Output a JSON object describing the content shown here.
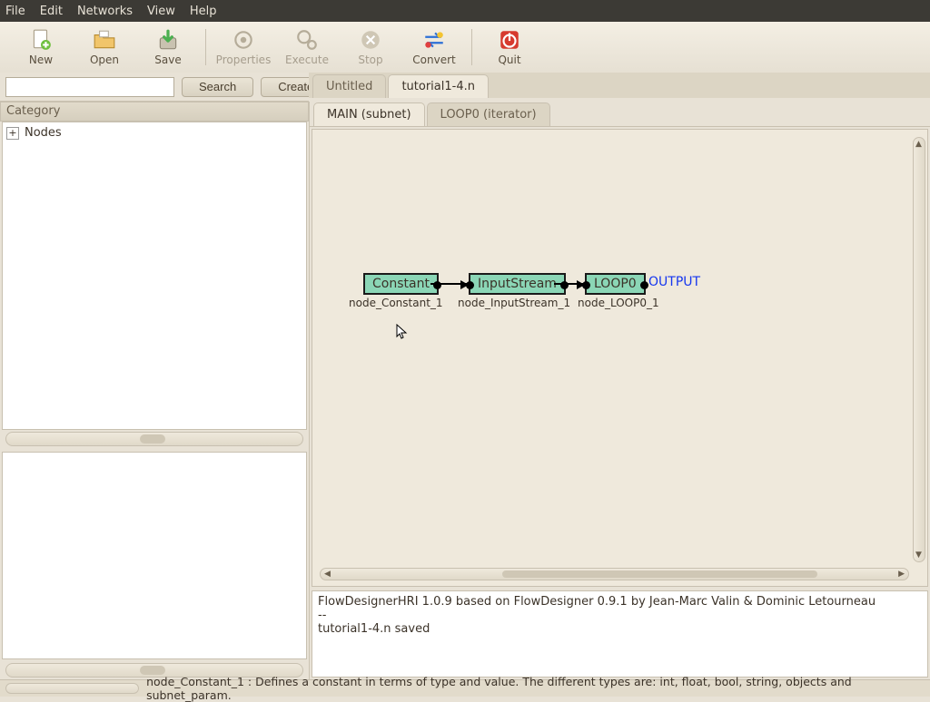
{
  "menu": {
    "items": [
      "File",
      "Edit",
      "Networks",
      "View",
      "Help"
    ]
  },
  "toolbar": {
    "new": "New",
    "open": "Open",
    "save": "Save",
    "properties": "Properties",
    "execute": "Execute",
    "stop": "Stop",
    "convert": "Convert",
    "quit": "Quit"
  },
  "search": {
    "placeholder": "",
    "value": "",
    "search_btn": "Search",
    "create_btn": "Create"
  },
  "sidebar": {
    "category_header": "Category",
    "tree": {
      "root": "Nodes"
    }
  },
  "doc_tabs": {
    "items": [
      "Untitled",
      "tutorial1-4.n"
    ],
    "active_index": 1
  },
  "sub_tabs": {
    "items": [
      "MAIN (subnet)",
      "LOOP0 (iterator)"
    ],
    "active_index": 0
  },
  "graph": {
    "nodes": [
      {
        "label": "Constant",
        "id": "node_Constant_1"
      },
      {
        "label": "InputStream",
        "id": "node_InputStream_1"
      },
      {
        "label": "LOOP0",
        "id": "node_LOOP0_1"
      }
    ],
    "output_label": "OUTPUT"
  },
  "log": {
    "line1": "FlowDesignerHRI 1.0.9 based on FlowDesigner 0.9.1 by Jean-Marc Valin & Dominic Letourneau",
    "line2": "--",
    "line3": "tutorial1-4.n saved"
  },
  "status": "node_Constant_1 : Defines a constant in terms of type and value. The different types are: int, float, bool, string, objects and subnet_param."
}
